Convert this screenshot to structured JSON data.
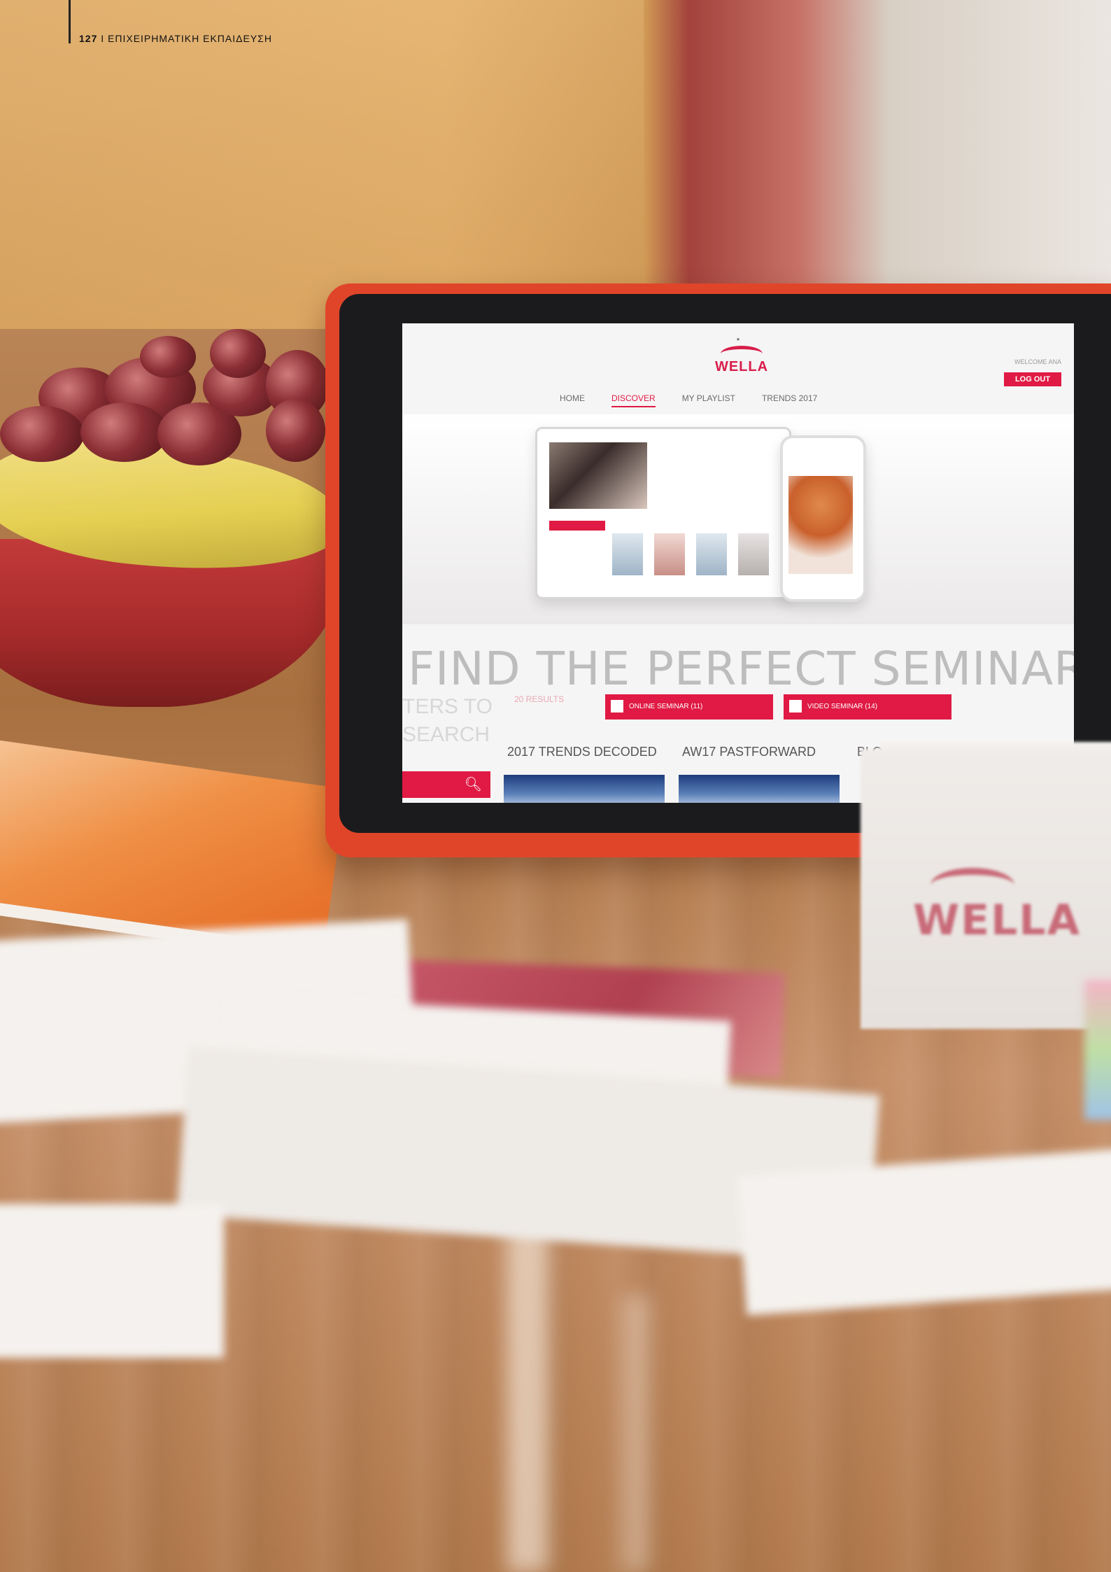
{
  "header": {
    "page_number": "127",
    "separator": "I",
    "section_title": "ΕΠΙΧΕΙΡΗΜΑΤΙΚΗ ΕΚΠΑΙΔΕΥΣΗ"
  },
  "tablet_screen": {
    "brand": "WELLA",
    "welcome": "WELCOME ANA",
    "logout_label": "LOG OUT",
    "nav": [
      "HOME",
      "DISCOVER",
      "MY PLAYLIST",
      "TRENDS 2017"
    ],
    "headline": "FIND THE PERFECT SEMINAR",
    "side_text_1": "TERS TO",
    "side_text_2": "SEARCH",
    "results_count": "20 RESULTS",
    "filters": [
      "ONLINE SEMINAR (11)",
      "VIDEO SEMINAR (14)"
    ],
    "trends": [
      "2017 TRENDS DECODED",
      "AW17 PASTFORWARD",
      "BLON"
    ],
    "search_icon": "search-icon"
  },
  "box": {
    "brand": "WELLA"
  },
  "colors": {
    "accent": "#e01a44",
    "tablet_case": "#e0452a"
  }
}
